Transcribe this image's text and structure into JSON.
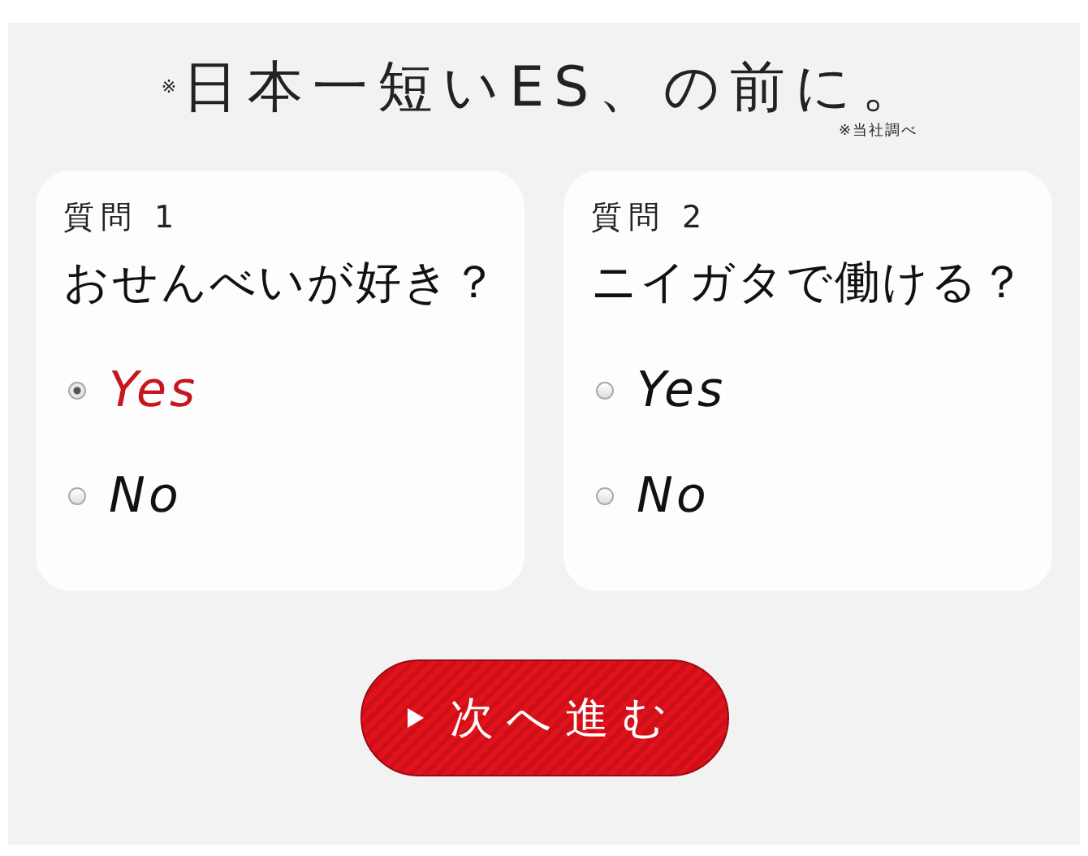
{
  "header": {
    "title": "$^{※}$日本一短いES、の前に。",
    "note": "※当社調べ"
  },
  "questions": [
    {
      "label": "質問 1",
      "text": "おせんべいが好き？",
      "options": [
        {
          "label": "Yes",
          "selected": true
        },
        {
          "label": "No",
          "selected": false
        }
      ]
    },
    {
      "label": "質問 2",
      "text": "ニイガタで働ける？",
      "options": [
        {
          "label": "Yes",
          "selected": false
        },
        {
          "label": "No",
          "selected": false
        }
      ]
    }
  ],
  "next_button": {
    "label": "次へ進む"
  }
}
